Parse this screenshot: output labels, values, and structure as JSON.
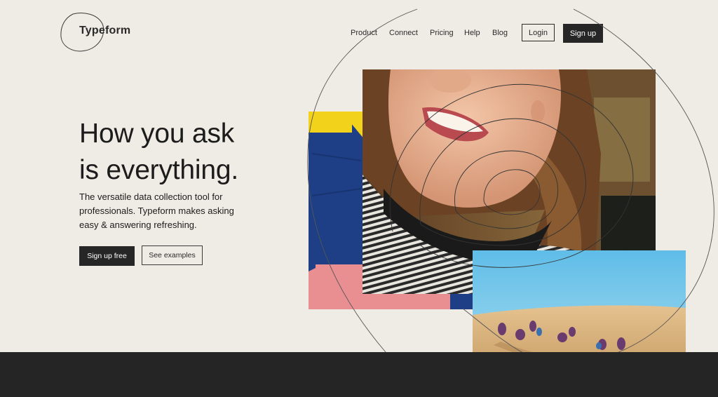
{
  "brand": {
    "name": "Typeform"
  },
  "nav": {
    "items": [
      "Product",
      "Connect",
      "Pricing",
      "Help",
      "Blog"
    ],
    "login_label": "Login",
    "signup_label": "Sign up"
  },
  "hero": {
    "title_lines": [
      "How you ask",
      "is everything."
    ],
    "subtitle_lines": [
      "The versatile data collection tool for",
      "professionals. Typeform makes asking",
      "easy & answering refreshing."
    ],
    "primary_cta": "Sign up free",
    "secondary_cta": "See examples"
  },
  "colors": {
    "background": "#efebe5",
    "dark": "#262626",
    "footer": "#252525",
    "accent_yellow": "#f3d21c",
    "accent_blue": "#1e3f86",
    "accent_pink": "#e98f92",
    "sky": "#6bc3e6"
  },
  "images": [
    {
      "name": "hero-photo-smiling-woman",
      "alt": ""
    },
    {
      "name": "desert-photo-group",
      "alt": ""
    },
    {
      "name": "collage-color-blocks",
      "alt": ""
    }
  ]
}
